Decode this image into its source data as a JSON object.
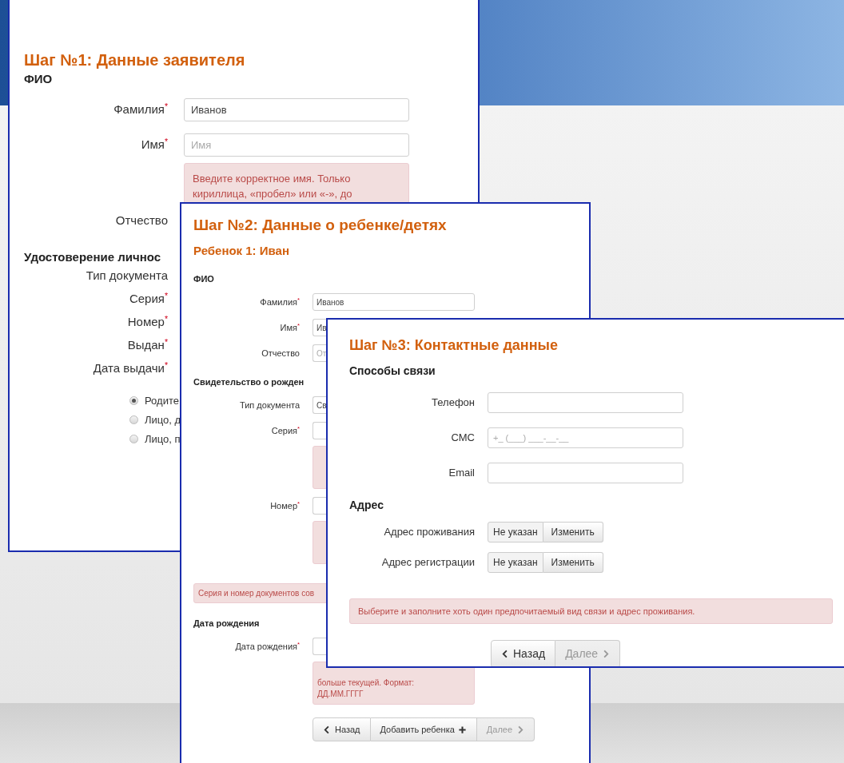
{
  "panels": [
    {
      "title": "Шаг №1: Данные заявителя",
      "items": [
        {
          "kind": "section",
          "text": "ФИО"
        },
        {
          "kind": "field",
          "label": "Фамилия$^{*}$",
          "value": "Иванов"
        },
        {
          "kind": "field",
          "label": "Имя$^{*}$",
          "placeholder": "Имя"
        },
        {
          "kind": "error",
          "lines": [
            "Введите корректное имя. Только",
            "кириллица, «пробел» или «-», до"
          ]
        },
        {
          "kind": "label",
          "label": "Отчество"
        },
        {
          "kind": "section",
          "text": "Удостоверение личнос"
        },
        {
          "kind": "label",
          "label": "Тип документа"
        },
        {
          "kind": "label",
          "label": "Серия$^{*}$"
        },
        {
          "kind": "label",
          "label": "Номер$^{*}$"
        },
        {
          "kind": "label",
          "label": "Выдан$^{*}$"
        },
        {
          "kind": "label",
          "label": "Дата выдачи$^{*}$"
        },
        {
          "kind": "radio",
          "label": "Родите",
          "selected": true
        },
        {
          "kind": "radio",
          "label": "Лицо, д",
          "selected": false
        },
        {
          "kind": "radio",
          "label": "Лицо, п",
          "selected": false
        }
      ]
    },
    {
      "title": "Шаг №2: Данные о ребенке/детях",
      "items": [
        {
          "kind": "subtitle",
          "text": "Ребенок 1: Иван"
        },
        {
          "kind": "section",
          "text": "ФИО"
        },
        {
          "kind": "field",
          "label": "Фамилия$^{*}$",
          "value": "Иванов"
        },
        {
          "kind": "field",
          "label": "Имя$^{*}$",
          "value": "Ив"
        },
        {
          "kind": "field",
          "label": "Отчество",
          "placeholder": "От"
        },
        {
          "kind": "section",
          "text": "Свидетельство о рожден"
        },
        {
          "kind": "field",
          "label": "Тип документа",
          "value": "Св"
        },
        {
          "kind": "field",
          "label": "Серия$^{*}$"
        },
        {
          "kind": "error"
        },
        {
          "kind": "field",
          "label": "Номер$^{*}$"
        },
        {
          "kind": "error"
        },
        {
          "kind": "notice",
          "text": "Серия и номер документов сов"
        },
        {
          "kind": "section",
          "text": "Дата рождения"
        },
        {
          "kind": "field",
          "label": "Дата рождения$^{*}$"
        },
        {
          "kind": "error",
          "lines": [
            "больше текущей. Формат:",
            "ДД.ММ.ГГГГ"
          ]
        }
      ],
      "buttons": [
        {
          "label": "Назад",
          "disabled": false
        },
        {
          "label": "Добавить ребенка",
          "disabled": false
        },
        {
          "label": "Далее",
          "disabled": true
        }
      ]
    },
    {
      "title": "Шаг №3: Контактные данные",
      "items": [
        {
          "kind": "section",
          "text": "Способы связи"
        },
        {
          "kind": "field",
          "label": "Телефон"
        },
        {
          "kind": "field",
          "label": "СМС",
          "placeholder": "+_ (___) ___-__-__"
        },
        {
          "kind": "field",
          "label": "Email"
        },
        {
          "kind": "section",
          "text": "Адрес"
        },
        {
          "kind": "address",
          "label": "Адрес проживания",
          "value": "Не указан",
          "action": "Изменить"
        },
        {
          "kind": "address",
          "label": "Адрес регистрации",
          "value": "Не указан",
          "action": "Изменить"
        },
        {
          "kind": "notice",
          "text": "Выберите и заполните хоть один предпочитаемый вид связи и адрес проживания."
        }
      ],
      "buttons": [
        {
          "label": "Назад",
          "disabled": false
        },
        {
          "label": "Далее",
          "disabled": true
        }
      ]
    }
  ]
}
